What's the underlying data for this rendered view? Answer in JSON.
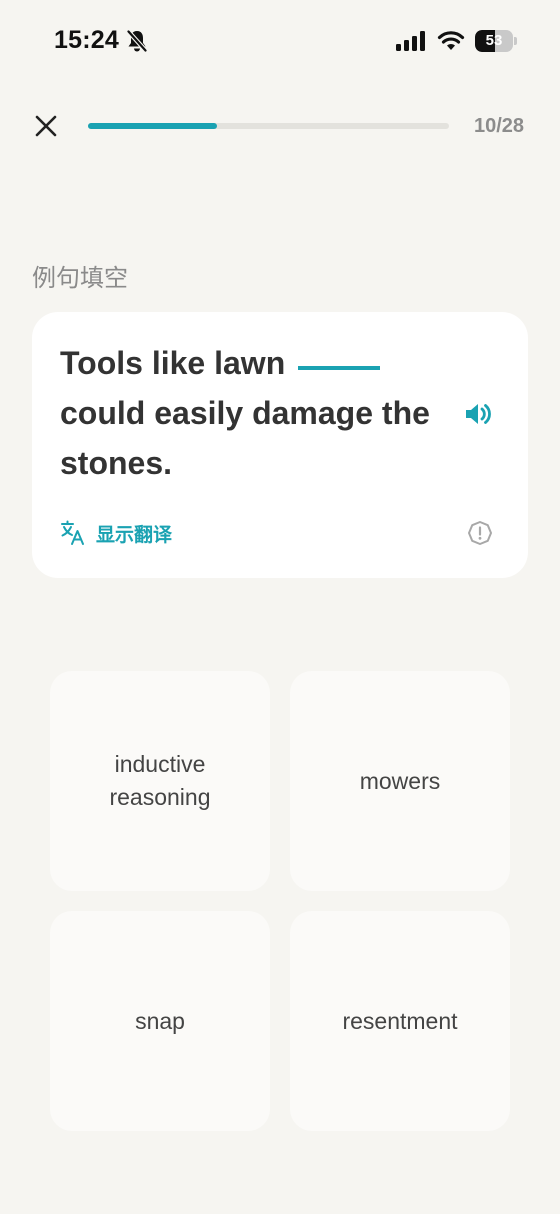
{
  "status_bar": {
    "time": "15:24",
    "battery_level": "53",
    "battery_fraction": 0.53,
    "icons": [
      "bell-slash-icon",
      "cellular-signal-icon",
      "wifi-icon",
      "battery-icon"
    ]
  },
  "header": {
    "close_icon": "close-icon",
    "progress_current": 10,
    "progress_total": 28,
    "progress_fraction": 0.357,
    "progress_text": "10/28"
  },
  "section_label": "例句填空",
  "question": {
    "sentence_before": "Tools like lawn",
    "sentence_after": "could easily damage the stones.",
    "speaker_icon": "speaker-icon",
    "translate_icon": "translate-icon",
    "show_translation_label": "显示翻译",
    "report_icon": "report-icon"
  },
  "options": [
    {
      "label": "inductive reasoning"
    },
    {
      "label": "mowers"
    },
    {
      "label": "snap"
    },
    {
      "label": "resentment"
    }
  ],
  "colors": {
    "background": "#f6f5f1",
    "accent": "#1aa2b2",
    "card": "#ffffff",
    "option": "#fbfaf8"
  }
}
